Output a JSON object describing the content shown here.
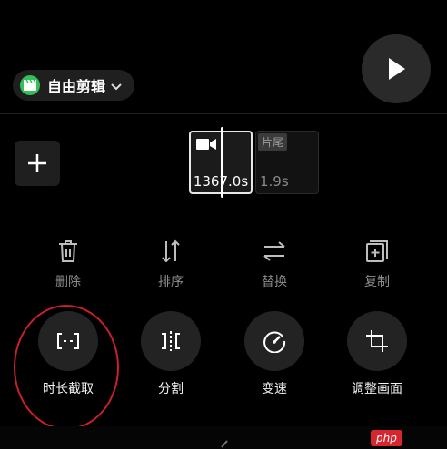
{
  "header": {
    "project_mode_label": "自由剪辑"
  },
  "timeline": {
    "clip_duration": "1367.0s",
    "ending_tag": "片尾",
    "ending_duration": "1.9s"
  },
  "tools_row1": [
    {
      "label": "删除",
      "icon": "trash-icon"
    },
    {
      "label": "排序",
      "icon": "sort-icon"
    },
    {
      "label": "替换",
      "icon": "swap-icon"
    },
    {
      "label": "复制",
      "icon": "copy-icon"
    }
  ],
  "tools_row2": [
    {
      "label": "时长截取",
      "icon": "trim-icon"
    },
    {
      "label": "分割",
      "icon": "split-icon"
    },
    {
      "label": "变速",
      "icon": "speed-icon"
    },
    {
      "label": "调整画面",
      "icon": "crop-icon"
    }
  ],
  "watermark": "php",
  "colors": {
    "background": "#000000",
    "accent_green": "#33c05a",
    "highlight_red": "#c9202a",
    "disabled_text": "#8d8d8d"
  }
}
